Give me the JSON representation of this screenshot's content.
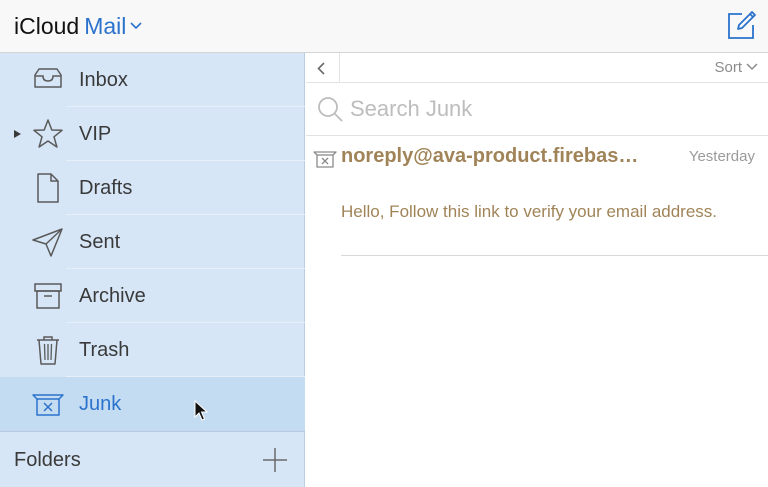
{
  "header": {
    "brand": "iCloud",
    "product": "Mail",
    "compose_icon": "compose-icon",
    "accent_color": "#2b72cc"
  },
  "sidebar": {
    "items": [
      {
        "label": "Inbox",
        "icon": "inbox-icon"
      },
      {
        "label": "VIP",
        "icon": "star-icon"
      },
      {
        "label": "Drafts",
        "icon": "document-icon"
      },
      {
        "label": "Sent",
        "icon": "paper-plane-icon"
      },
      {
        "label": "Archive",
        "icon": "archive-box-icon"
      },
      {
        "label": "Trash",
        "icon": "trash-icon"
      },
      {
        "label": "Junk",
        "icon": "junk-icon",
        "selected": true
      }
    ],
    "folders_label": "Folders",
    "background_color": "#d6e6f6",
    "selected_color": "#c4dcf2"
  },
  "toolbar": {
    "sort_label": "Sort"
  },
  "search": {
    "placeholder": "Search Junk",
    "value": ""
  },
  "messages": [
    {
      "sender": "noreply@ava-product.firebaseap...",
      "date": "Yesterday",
      "preview": "Hello, Follow this link to verify your email address.",
      "sender_color": "#a08458"
    }
  ]
}
